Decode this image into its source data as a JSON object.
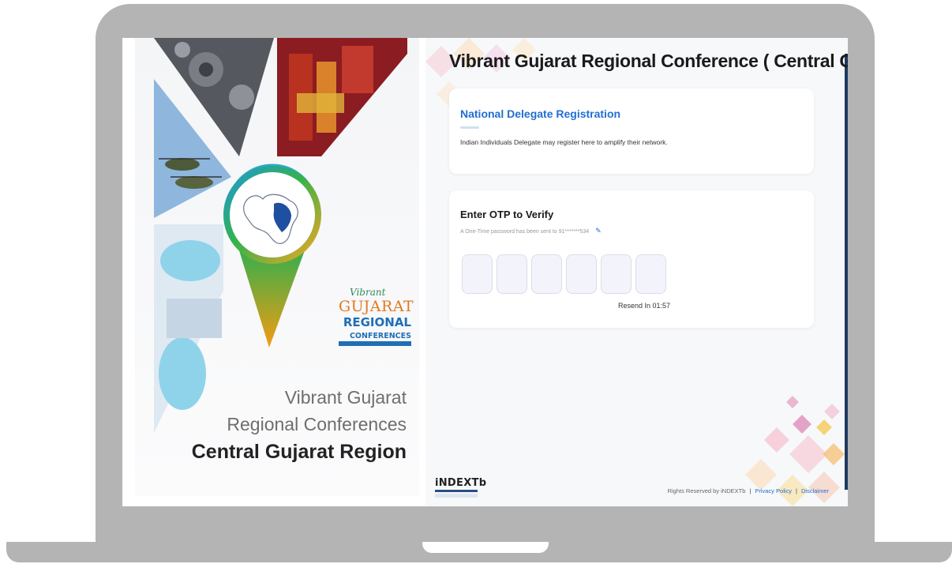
{
  "hero": {
    "logo": {
      "vibrant": "Vibrant",
      "gujarat": "GUJARAT",
      "regional": "REGIONAL",
      "conferences": "CONFERENCES"
    },
    "title_line1": "Vibrant Gujarat",
    "title_line2": "Regional Conferences",
    "title_line3": "Central Gujarat Region"
  },
  "page": {
    "title": "Vibrant Gujarat Regional Conference ( Central Gujarat )"
  },
  "registration_card": {
    "title": "National Delegate Registration",
    "description": "Indian Individuals Delegate may register here to amplify their network."
  },
  "otp_card": {
    "title": "Enter OTP to Verify",
    "subtitle": "A One-Time password has been sent to 91*******534",
    "edit_icon": "pencil-icon",
    "boxes": [
      "",
      "",
      "",
      "",
      "",
      ""
    ],
    "resend_text": "Resend In 01:57"
  },
  "footer": {
    "org_logo": "iNDEXTb",
    "rights_text": "Rights Reserved by iNDEXTb",
    "privacy_link": "Privacy Policy",
    "disclaimer_link": "Disclaimer",
    "separator": "|"
  },
  "colors": {
    "accent_blue": "#1f6fd2",
    "frame_gray": "#b4b4b4",
    "logo_orange": "#e07a1f",
    "logo_green": "#2e8b57"
  }
}
